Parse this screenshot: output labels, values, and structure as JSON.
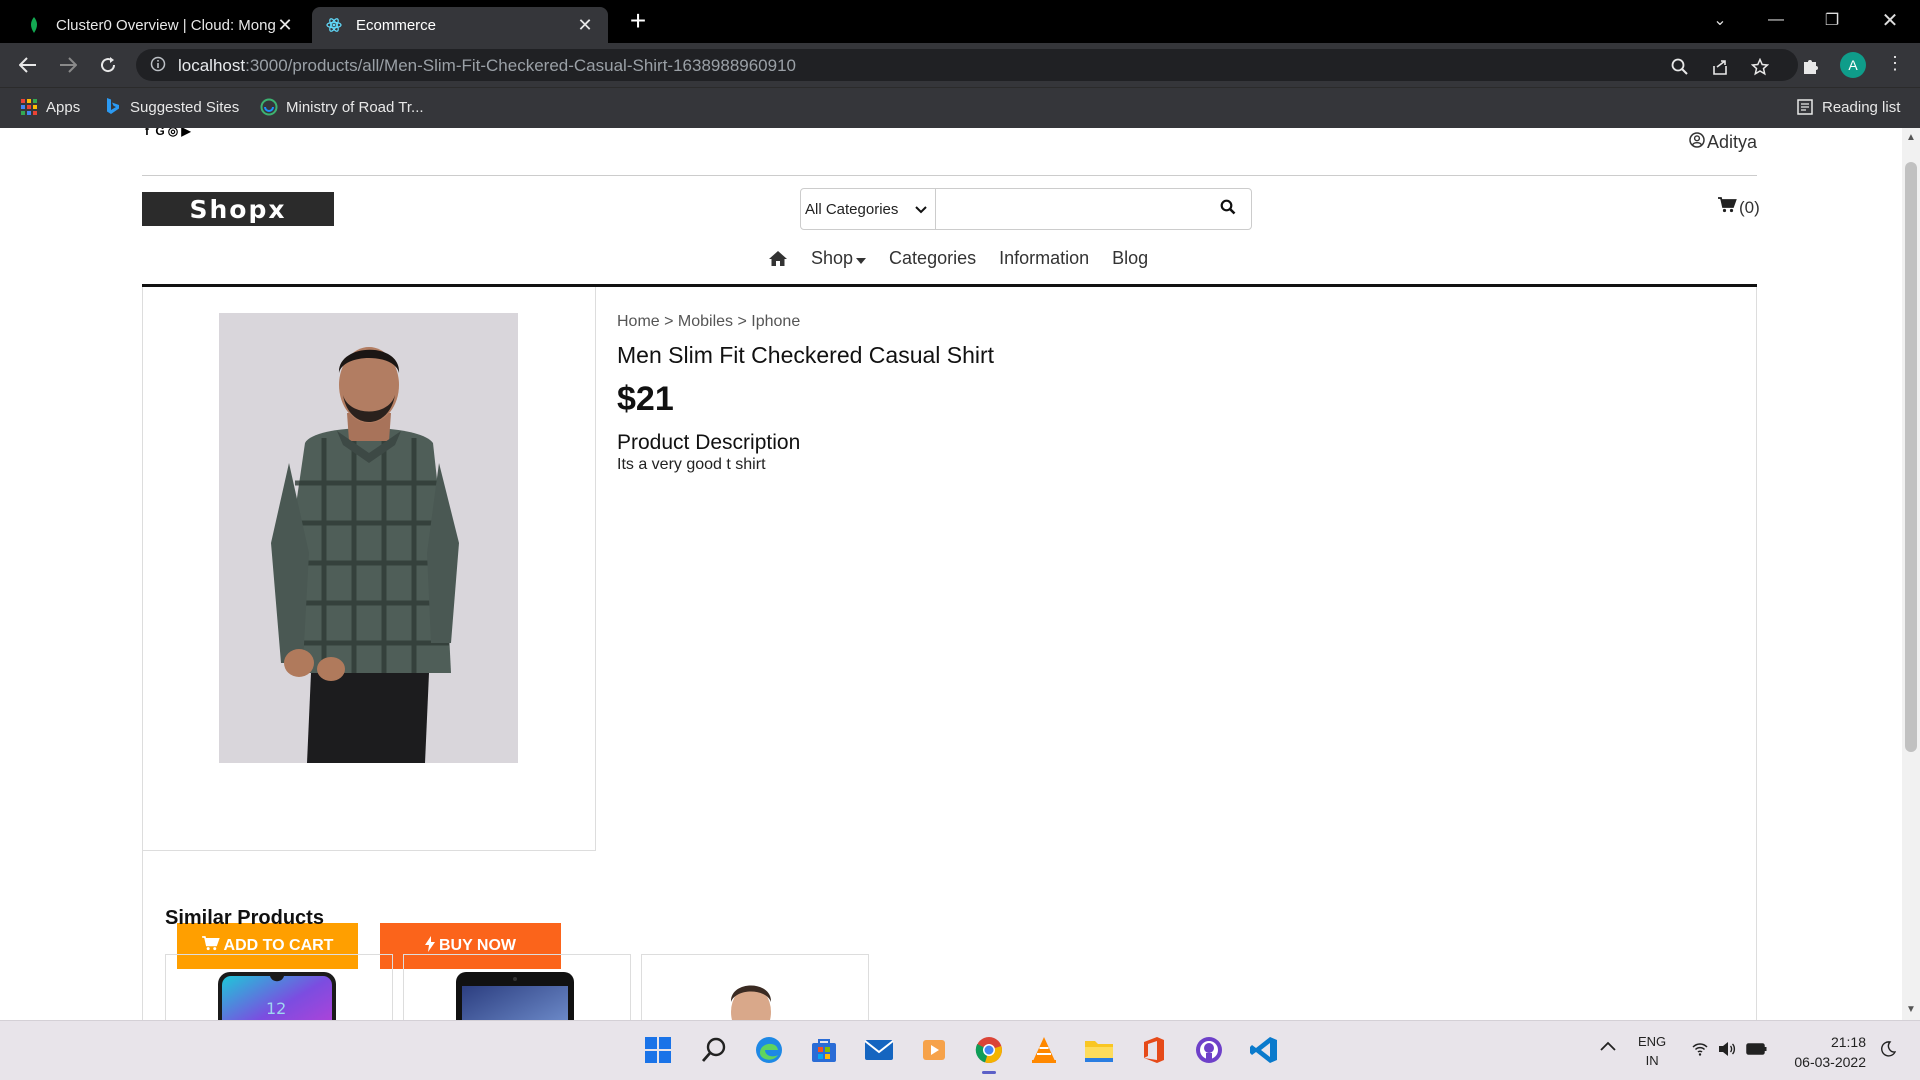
{
  "browser": {
    "tabs": [
      {
        "title": "Cluster0 Overview | Cloud: Mong",
        "active": false,
        "icon": "mongodb-leaf-icon"
      },
      {
        "title": "Ecommerce",
        "active": true,
        "icon": "react-atom-icon"
      }
    ],
    "url_host": "localhost",
    "url_path": ":3000/products/all/Men-Slim-Fit-Checkered-Casual-Shirt-1638988960910",
    "profile_initial": "A",
    "bookmarks": [
      {
        "label": "Apps",
        "icon": "apps-grid-icon"
      },
      {
        "label": "Suggested Sites",
        "icon": "bing-icon"
      },
      {
        "label": "Ministry of Road Tr...",
        "icon": "globe-icon"
      }
    ],
    "reading_list": "Reading list"
  },
  "site": {
    "user": "Aditya",
    "logo": "Shopx",
    "search": {
      "category": "All Categories",
      "placeholder": ""
    },
    "cart_count": "(0)",
    "nav": {
      "shop": "Shop",
      "categories": "Categories",
      "information": "Information",
      "blog": "Blog"
    }
  },
  "product": {
    "breadcrumb": "Home > Mobiles > Iphone",
    "name": "Men Slim Fit Checkered Casual Shirt",
    "price": "$21",
    "description_heading": "Product Description",
    "description": "Its a very good t shirt",
    "add_to_cart": "ADD TO CART",
    "buy_now": "BUY NOW"
  },
  "similar": {
    "heading": "Similar Products",
    "items": [
      {
        "kind": "phone",
        "screen_text": "12"
      },
      {
        "kind": "phone"
      },
      {
        "kind": "person"
      }
    ]
  },
  "taskbar": {
    "lang_1": "ENG",
    "lang_2": "IN",
    "time": "21:18",
    "date": "06-03-2022"
  },
  "colors": {
    "add_to_cart": "#ff9f00",
    "buy_now": "#fb641b",
    "logo_bg": "#2b2b2b"
  }
}
